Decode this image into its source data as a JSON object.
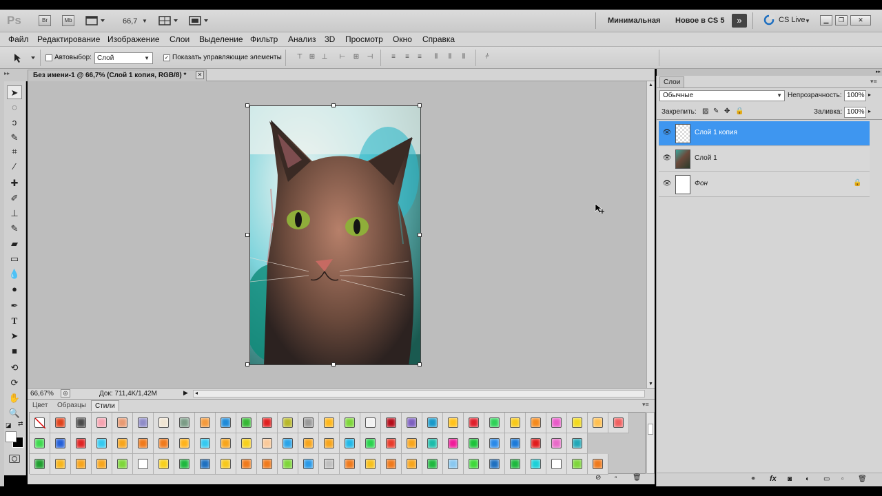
{
  "app": {
    "logo": "Ps",
    "bridge": "Br",
    "minibridge": "Mb",
    "zoom": "66,7",
    "workspace_minimal": "Минимальная",
    "workspace_new": "Новое в CS 5",
    "more": "»",
    "cslive": "CS Live"
  },
  "menu": [
    "Файл",
    "Редактирование",
    "Изображение",
    "Слои",
    "Выделение",
    "Фильтр",
    "Анализ",
    "3D",
    "Просмотр",
    "Окно",
    "Справка"
  ],
  "options": {
    "autoselect_label": "Автовыбор:",
    "autoselect_value": "Слой",
    "show_controls_label": "Показать управляющие элементы",
    "show_controls_checked": true
  },
  "document": {
    "tab_title": "Без имени-1 @ 66,7% (Слой 1 копия, RGB/8) *",
    "zoom_status": "66,67%",
    "doc_info": "Док: 711,4K/1,42M"
  },
  "styles_panel": {
    "tabs": [
      "Цвет",
      "Образцы",
      "Стили"
    ],
    "active_tab": "Стили",
    "swatches": [
      [
        "none",
        "#e0431c",
        "#4a4a4a",
        "#f5a3b0",
        "#e89a72",
        "#8f8cc8",
        "#efe4d2",
        "#7b9c86",
        "#f39a3c",
        "#1e8ad8",
        "#35b734",
        "#e02020",
        "#b8b82a",
        "#9a9a9a",
        "#ffb81c",
        "#7ed63a",
        "#f0f0f0",
        "#b50d1a",
        "#7d60c0",
        "#1899c9",
        "#ffc21a",
        "#e01e2a",
        "#2ed158",
        "#f8c918",
        "#f58a1c",
        "#e85ac8",
        "#f2da1e",
        "#ffc050",
        "#f06060"
      ],
      [
        "#3fd94f",
        "#2560d8",
        "#e02424",
        "#35c9f0",
        "#f7a51c",
        "#f07a1c",
        "#f07a1c",
        "#ffb31c",
        "#35c9f0",
        "#f7a51c",
        "#f7d01c",
        "#f9c99a",
        "#2aa4e8",
        "#f7a51c",
        "#f7a51c",
        "#22b8e8",
        "#2ad24e",
        "#e83a2a",
        "#f7a51c",
        "#1cbcaa",
        "#f01c9a",
        "#1cc23a",
        "#2a8ae8",
        "#1c7ad8",
        "#e01c1c",
        "#e86ac8",
        "#22a8b8"
      ],
      [
        "#1e9e2e",
        "#f7b51c",
        "#f7a51c",
        "#f7a51c",
        "#7ed63a",
        "#ffffff",
        "#f7d01c",
        "#1eb83e",
        "#1e70c0",
        "#f7c81c",
        "#f07a1c",
        "#f07a1c",
        "#7ed63a",
        "#2a9ae8",
        "#c0c0c0",
        "#f07a1c",
        "#f7c01c",
        "#f07a1c",
        "#f7a51c",
        "#1eb83e",
        "#8ac8f0",
        "#3ed93a",
        "#1e70c0",
        "#1eb83e",
        "#1cd0d8",
        "#ffffff",
        "#7ed63a",
        "#f07a1c"
      ]
    ]
  },
  "layers_panel": {
    "tab": "Слои",
    "blend_mode": "Обычные",
    "opacity_label": "Непрозрачность:",
    "opacity": "100%",
    "lock_label": "Закрепить:",
    "fill_label": "Заливка:",
    "fill": "100%",
    "layers": [
      {
        "name": "Слой 1 копия",
        "selected": true
      },
      {
        "name": "Слой 1",
        "selected": false
      },
      {
        "name": "Фон",
        "selected": false,
        "locked": true
      }
    ]
  }
}
